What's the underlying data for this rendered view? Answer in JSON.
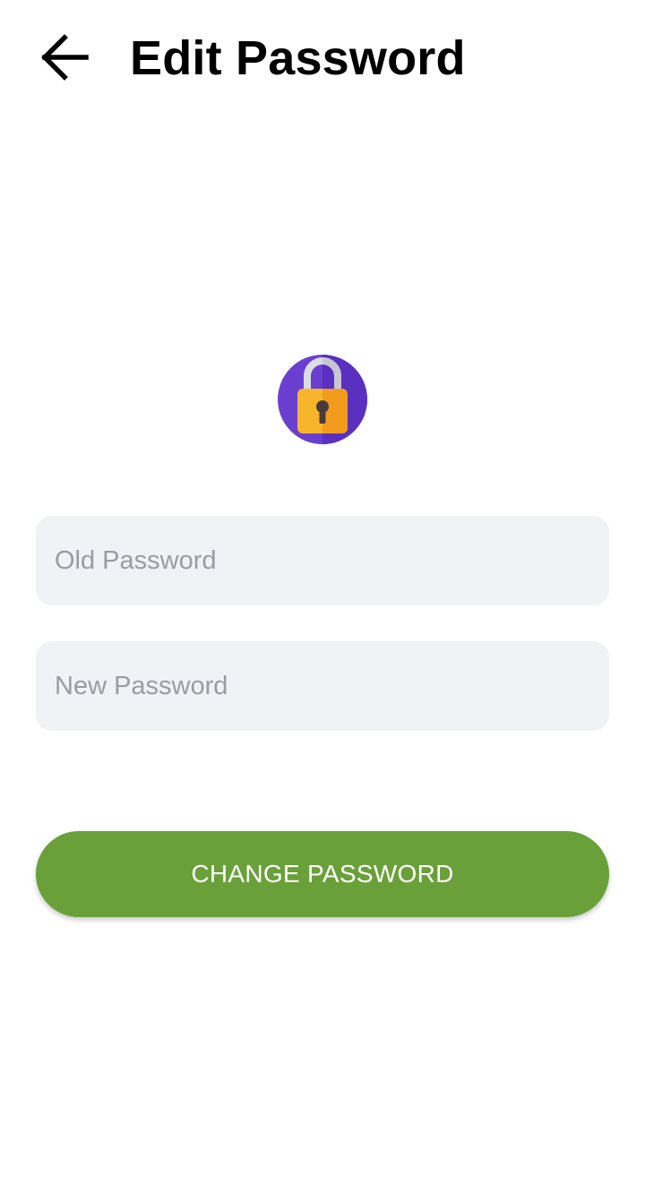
{
  "header": {
    "title": "Edit Password",
    "back_icon": "arrow-left-icon"
  },
  "hero": {
    "icon": "padlock-icon",
    "colors": {
      "circle": "#6a3fd0",
      "lock_body": "#f7b52c",
      "shackle": "#dcdce4",
      "keyhole": "#4a3b3b"
    }
  },
  "form": {
    "old_password": {
      "value": "",
      "placeholder": "Old Password"
    },
    "new_password": {
      "value": "",
      "placeholder": "New Password"
    },
    "submit_label": "CHANGE PASSWORD"
  },
  "colors": {
    "field_background": "#f1f2f6",
    "button_background": "#6aa03a",
    "button_text": "#ffffff",
    "placeholder_text": "#9a9ca2"
  }
}
